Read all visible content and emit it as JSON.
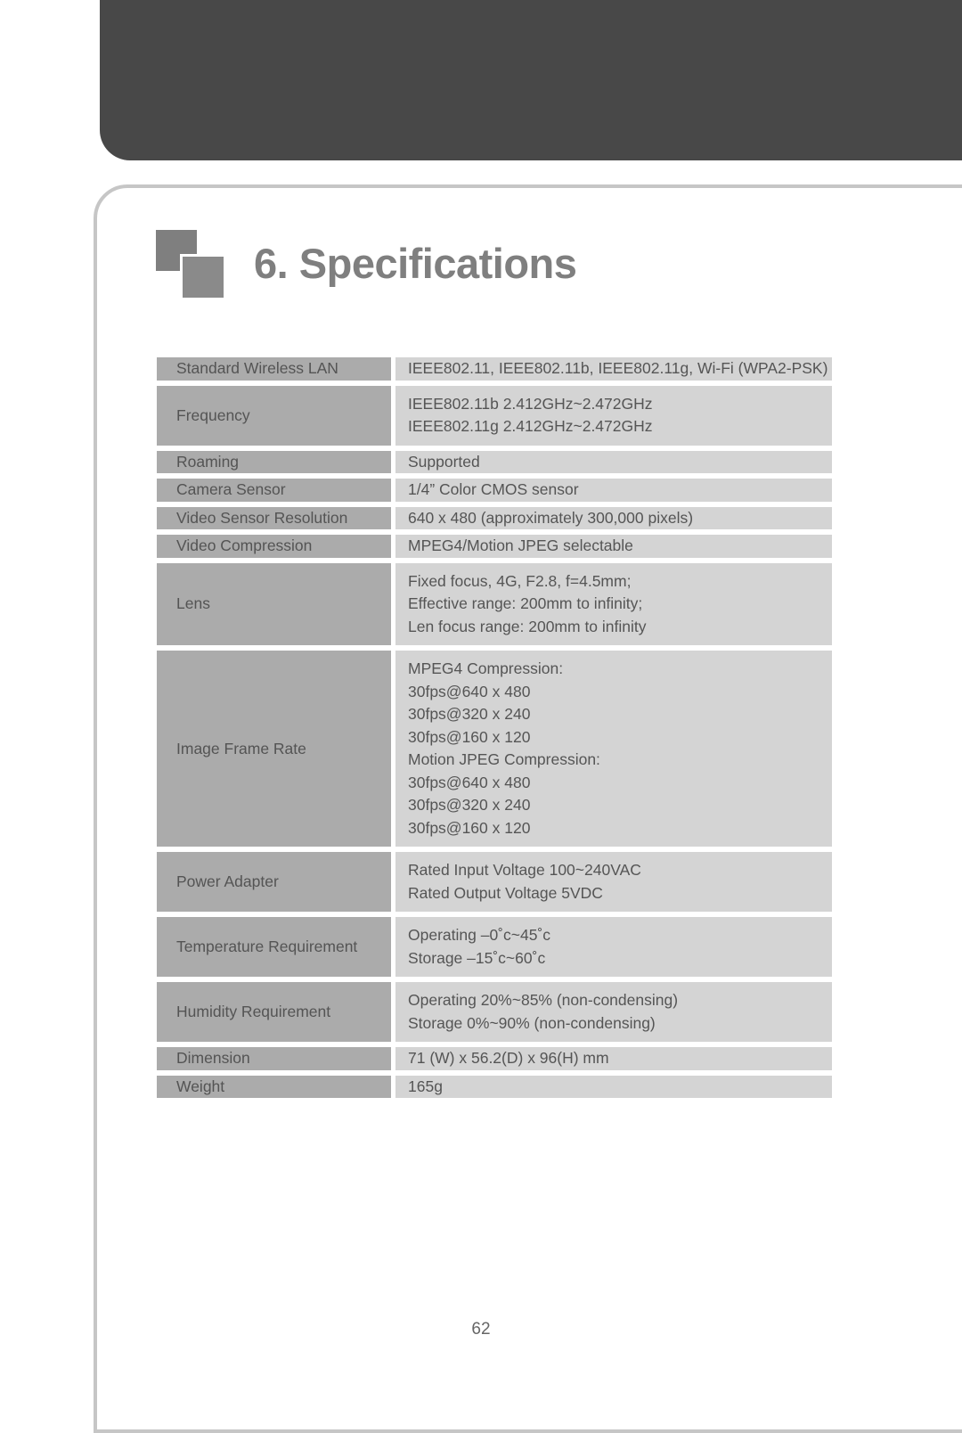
{
  "page": {
    "number": "62",
    "title": "6. Specifications",
    "logo_icon": "two-squares-logo-icon"
  },
  "spec_table": {
    "rows": [
      {
        "label": "Standard Wireless LAN",
        "lines": [
          "IEEE802.11, IEEE802.11b, IEEE802.11g, Wi-Fi (WPA2-PSK)"
        ]
      },
      {
        "label": "Frequency",
        "lines": [
          "IEEE802.11b  2.412GHz~2.472GHz",
          "IEEE802.11g  2.412GHz~2.472GHz"
        ]
      },
      {
        "label": "Roaming",
        "lines": [
          "Supported"
        ]
      },
      {
        "label": "Camera Sensor",
        "lines": [
          "1/4” Color CMOS sensor"
        ]
      },
      {
        "label": "Video Sensor Resolution",
        "lines": [
          "640 x 480 (approximately 300,000 pixels)"
        ]
      },
      {
        "label": "Video Compression",
        "lines": [
          "MPEG4/Motion JPEG selectable"
        ]
      },
      {
        "label": "Lens",
        "lines": [
          "Fixed focus, 4G, F2.8, f=4.5mm;",
          "Effective range: 200mm to infinity;",
          "Len focus range: 200mm to infinity"
        ]
      },
      {
        "label": "Image Frame Rate",
        "lines": [
          "MPEG4 Compression:",
          "30fps@640 x 480",
          "30fps@320 x 240",
          "30fps@160 x 120",
          "Motion JPEG Compression:",
          "30fps@640 x 480",
          "30fps@320 x 240",
          "30fps@160 x 120"
        ]
      },
      {
        "label": "Power Adapter",
        "lines": [
          "Rated Input Voltage 100~240VAC",
          "Rated Output Voltage 5VDC"
        ]
      },
      {
        "label": "Temperature Requirement",
        "lines": [
          "Operating –0˚c~45˚c",
          "Storage –15˚c~60˚c"
        ]
      },
      {
        "label": "Humidity Requirement",
        "lines": [
          "Operating  20%~85% (non-condensing)",
          "Storage   0%~90% (non-condensing)"
        ]
      },
      {
        "label": "Dimension",
        "lines": [
          "71 (W) x 56.2(D) x 96(H) mm"
        ]
      },
      {
        "label": "Weight",
        "lines": [
          "165g"
        ]
      }
    ]
  },
  "colors": {
    "header_band": "#484848",
    "frame_border": "#c6c6c6",
    "label_cell": "#ababab",
    "value_cell": "#d4d4d4",
    "title_text": "#7f7f7f",
    "body_text": "#555555"
  }
}
